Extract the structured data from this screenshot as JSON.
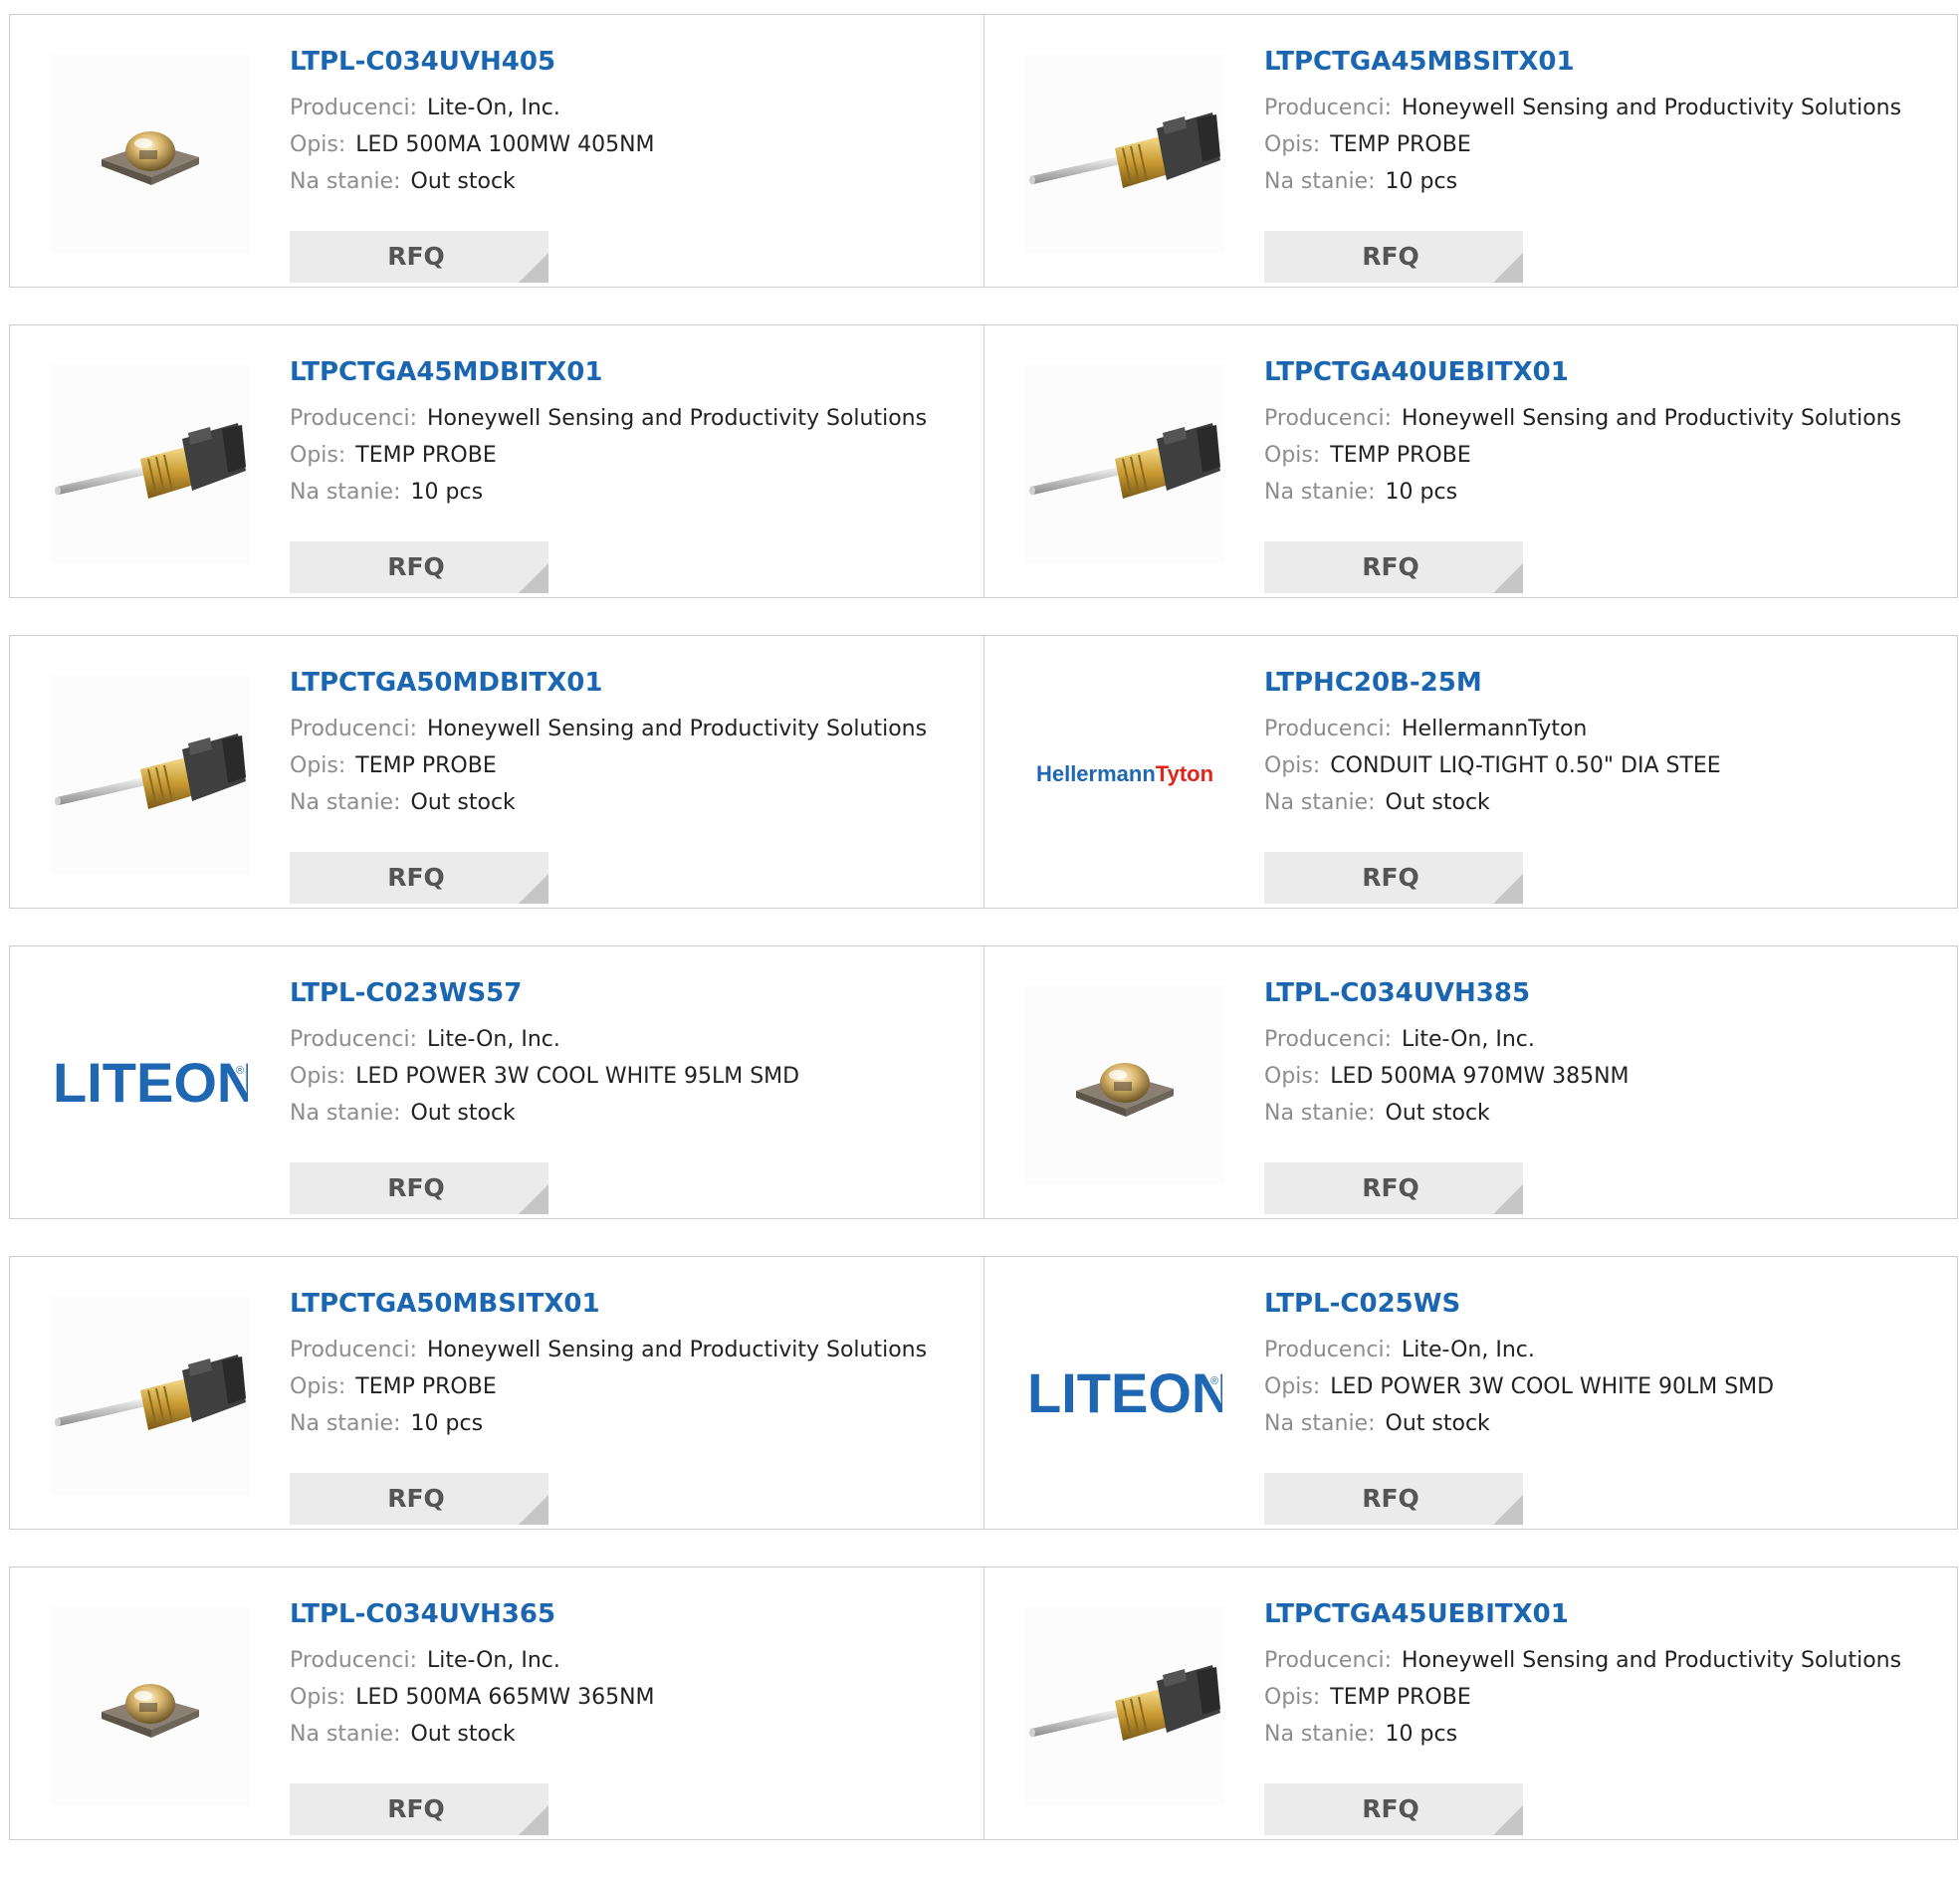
{
  "labels": {
    "manufacturer": "Producenci:",
    "description": "Opis:",
    "stock": "Na stanie:",
    "rfq": "RFQ"
  },
  "colors": {
    "title": "#1a66b0",
    "label": "#8d8d8d",
    "value": "#222222",
    "button_bg": "#ebebeb",
    "border": "#cfcfcf",
    "liteon_logo": "#1f66b3",
    "hellermann_blue": "#1f66b3",
    "hellermann_red": "#e2231a"
  },
  "logos": {
    "liteon": "LITEON",
    "hellermann_part1": "Hellermann",
    "hellermann_part2": "Tyton"
  },
  "products": [
    {
      "part": "LTPL-C034UVH405",
      "manufacturer": "Lite-On, Inc.",
      "description": "LED 500MA 100MW 405NM",
      "stock": "Out stock",
      "image": "uv-led-icon"
    },
    {
      "part": "LTPCTGA45MBSITX01",
      "manufacturer": "Honeywell Sensing and Productivity Solutions",
      "description": "TEMP PROBE",
      "stock": "10 pcs",
      "image": "temp-probe-icon"
    },
    {
      "part": "LTPCTGA45MDBITX01",
      "manufacturer": "Honeywell Sensing and Productivity Solutions",
      "description": "TEMP PROBE",
      "stock": "10 pcs",
      "image": "temp-probe-icon"
    },
    {
      "part": "LTPCTGA40UEBITX01",
      "manufacturer": "Honeywell Sensing and Productivity Solutions",
      "description": "TEMP PROBE",
      "stock": "10 pcs",
      "image": "temp-probe-icon"
    },
    {
      "part": "LTPCTGA50MDBITX01",
      "manufacturer": "Honeywell Sensing and Productivity Solutions",
      "description": "TEMP PROBE",
      "stock": "Out stock",
      "image": "temp-probe-icon"
    },
    {
      "part": "LTPHC20B-25M",
      "manufacturer": "HellermannTyton",
      "description": "CONDUIT LIQ-TIGHT 0.50\" DIA STEE",
      "stock": "Out stock",
      "image": "hellermanntyton-logo"
    },
    {
      "part": "LTPL-C023WS57",
      "manufacturer": "Lite-On, Inc.",
      "description": "LED POWER 3W COOL WHITE 95LM SMD",
      "stock": "Out stock",
      "image": "liteon-logo"
    },
    {
      "part": "LTPL-C034UVH385",
      "manufacturer": "Lite-On, Inc.",
      "description": "LED 500MA 970MW 385NM",
      "stock": "Out stock",
      "image": "uv-led-icon"
    },
    {
      "part": "LTPCTGA50MBSITX01",
      "manufacturer": "Honeywell Sensing and Productivity Solutions",
      "description": "TEMP PROBE",
      "stock": "10 pcs",
      "image": "temp-probe-icon"
    },
    {
      "part": "LTPL-C025WS",
      "manufacturer": "Lite-On, Inc.",
      "description": "LED POWER 3W COOL WHITE 90LM SMD",
      "stock": "Out stock",
      "image": "liteon-logo"
    },
    {
      "part": "LTPL-C034UVH365",
      "manufacturer": "Lite-On, Inc.",
      "description": "LED 500MA 665MW 365NM",
      "stock": "Out stock",
      "image": "uv-led-icon"
    },
    {
      "part": "LTPCTGA45UEBITX01",
      "manufacturer": "Honeywell Sensing and Productivity Solutions",
      "description": "TEMP PROBE",
      "stock": "10 pcs",
      "image": "temp-probe-icon"
    }
  ]
}
